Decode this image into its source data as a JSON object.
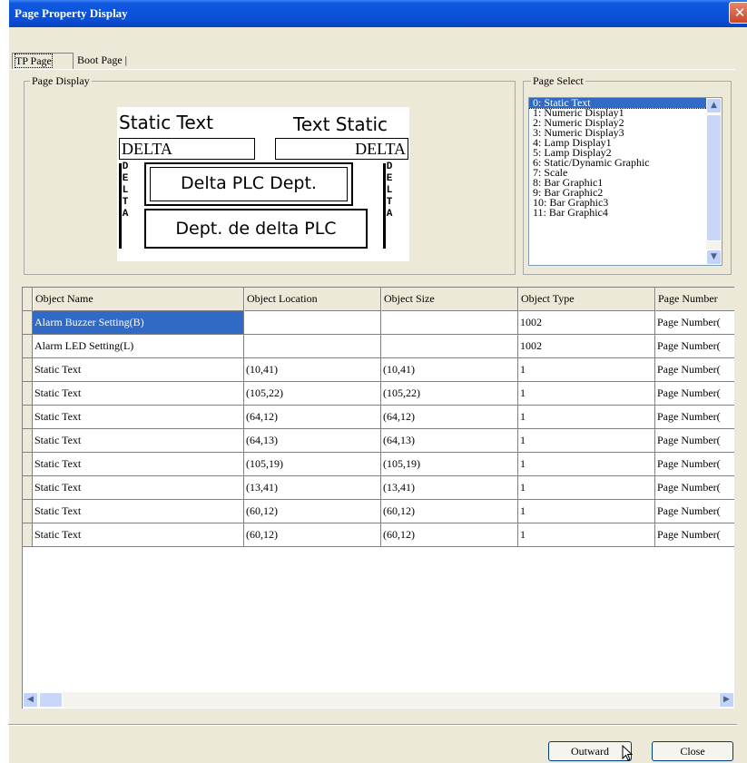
{
  "window": {
    "title": "Page Property Display",
    "close_glyph": "✕"
  },
  "tabs": [
    {
      "label": "TP Page",
      "active": true
    },
    {
      "label": "Boot Page",
      "active": false
    }
  ],
  "page_display": {
    "legend": "Page Display",
    "preview": {
      "static_text_left": "Static Text",
      "static_text_right": "Text Static",
      "delta_left": "DELTA",
      "delta_right": "DELTA",
      "framed_text": "Delta PLC Dept.",
      "dept_text": "Dept. de delta PLC",
      "vertical_left": "DELTA",
      "vertical_right": "DELTA"
    }
  },
  "page_select": {
    "legend": "Page Select",
    "items": [
      "0: Static Text",
      "1: Numeric Display1",
      "2: Numeric Display2",
      "3: Numeric Display3",
      "4: Lamp Display1",
      "5: Lamp Display2",
      "6: Static/Dynamic Graphic",
      "7: Scale",
      "8: Bar Graphic1",
      "9: Bar Graphic2",
      "10: Bar Graphic3",
      "11: Bar Graphic4"
    ],
    "selected_index": 0
  },
  "table": {
    "columns": [
      "Object Name",
      "Object Location",
      "Object Size",
      "Object Type",
      "Page Number"
    ],
    "rows": [
      [
        "Alarm Buzzer Setting(B)",
        "",
        "",
        "1002",
        "Page Number("
      ],
      [
        "Alarm LED Setting(L)",
        "",
        "",
        "1002",
        "Page Number("
      ],
      [
        "Static Text",
        "(10,41)",
        "(10,41)",
        "1",
        "Page Number("
      ],
      [
        "Static Text",
        "(105,22)",
        "(105,22)",
        "1",
        "Page Number("
      ],
      [
        "Static Text",
        "(64,12)",
        "(64,12)",
        "1",
        "Page Number("
      ],
      [
        "Static Text",
        "(64,13)",
        "(64,13)",
        "1",
        "Page Number("
      ],
      [
        "Static Text",
        "(105,19)",
        "(105,19)",
        "1",
        "Page Number("
      ],
      [
        "Static Text",
        "(13,41)",
        "(13,41)",
        "1",
        "Page Number("
      ],
      [
        "Static Text",
        "(60,12)",
        "(60,12)",
        "1",
        "Page Number("
      ],
      [
        "Static Text",
        "(60,12)",
        "(60,12)",
        "1",
        "Page Number("
      ]
    ],
    "selected_row": 0
  },
  "buttons": {
    "outward": "Outward",
    "close": "Close"
  },
  "colors": {
    "title_bar": "#0a4fd6",
    "selection": "#316ac5",
    "dialog_bg": "#ece9d8"
  }
}
